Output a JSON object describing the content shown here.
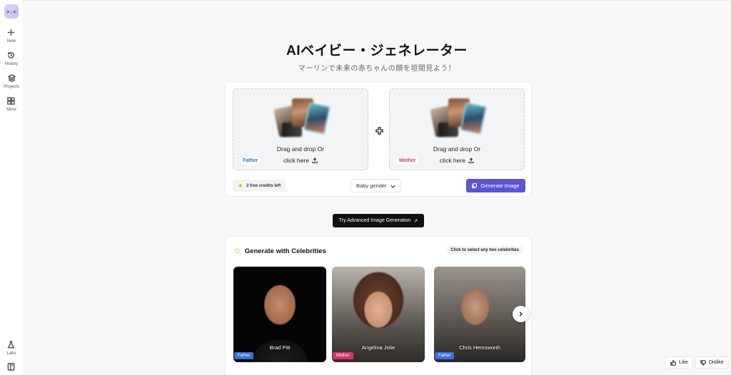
{
  "sidebar": {
    "logo_text": ">.<",
    "items": [
      {
        "label": "New",
        "icon": "plus-icon"
      },
      {
        "label": "History",
        "icon": "history-icon"
      },
      {
        "label": "Projects",
        "icon": "layers-icon"
      },
      {
        "label": "More",
        "icon": "grid-icon"
      }
    ],
    "bottom": [
      {
        "label": "Labs",
        "icon": "flask-icon"
      },
      {
        "label": "",
        "icon": "book-icon"
      }
    ]
  },
  "header": {
    "title": "AIベイビー・ジェネレーター",
    "subtitle": "マーリンで未来の赤ちゃんの顔を垣間見よう！"
  },
  "upload": {
    "drop_text": "Drag and drop Or",
    "click_text": "click here",
    "father_label": "Father",
    "mother_label": "Mother",
    "credits": "2 free credits left",
    "gender_placeholder": "Baby gender",
    "generate_label": "Generate Image"
  },
  "advanced": {
    "label": "Try Advanced Image Generation",
    "arrow": "↗"
  },
  "celebrities": {
    "title": "Generate with Celebrities",
    "hint": "Click to select any two celebrities",
    "items": [
      {
        "name": "Brad Pitt",
        "role": "Father"
      },
      {
        "name": "Angelina Jolie",
        "role": "Mother"
      },
      {
        "name": "Chris Hemsworth",
        "role": "Father"
      }
    ]
  },
  "feedback": {
    "like": "Like",
    "dislike": "Dislike"
  },
  "colors": {
    "accent": "#5b55d6",
    "father_badge": "#3b6fe0",
    "mother_badge": "#d6336c"
  }
}
